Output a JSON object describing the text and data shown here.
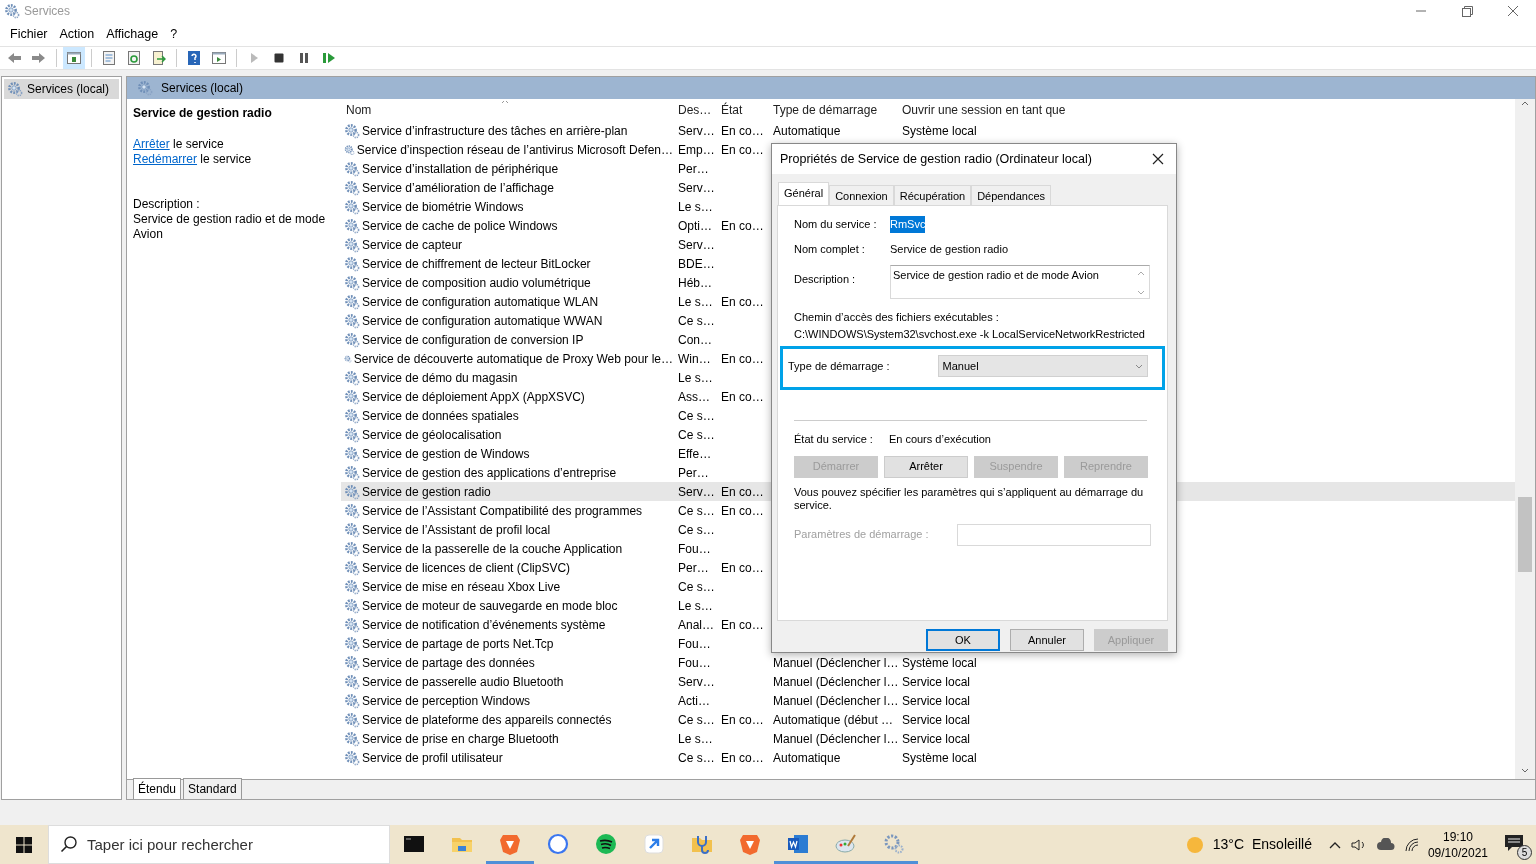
{
  "window": {
    "title": "Services"
  },
  "menu": [
    "Fichier",
    "Action",
    "Affichage",
    "?"
  ],
  "toolbar": [
    {
      "kind": "back",
      "disabled": false,
      "pressed": false
    },
    {
      "kind": "forward",
      "disabled": false,
      "pressed": false
    },
    {
      "kind": "tree",
      "disabled": false,
      "pressed": true
    },
    {
      "kind": "properties",
      "disabled": false,
      "pressed": false
    },
    {
      "kind": "refresh",
      "disabled": false,
      "pressed": false
    },
    {
      "kind": "export",
      "disabled": false,
      "pressed": false
    },
    {
      "kind": "help",
      "disabled": false,
      "pressed": false
    },
    {
      "kind": "view",
      "disabled": false,
      "pressed": false
    },
    {
      "kind": "play",
      "disabled": true,
      "pressed": false
    },
    {
      "kind": "stop",
      "disabled": false,
      "pressed": false
    },
    {
      "kind": "pause",
      "disabled": false,
      "pressed": false
    },
    {
      "kind": "resume",
      "disabled": false,
      "pressed": false
    }
  ],
  "tree": [
    {
      "label": "Services (local)",
      "selected": true
    }
  ],
  "panel_title": "Services (local)",
  "details": {
    "title": "Service de gestion radio",
    "actions": [
      {
        "link": "Arrêter",
        "text": "le service"
      },
      {
        "link": "Redémarrer",
        "text": "le service"
      }
    ],
    "description_label": "Description :",
    "description": "Service de gestion radio et de mode Avion"
  },
  "table": {
    "columns": [
      "Nom",
      "Des…",
      "État",
      "Type de démarrage",
      "Ouvrir une session en tant que"
    ],
    "rows": [
      {
        "name": "Service d’infrastructure des tâches en arrière-plan",
        "description": "Serv…",
        "state": "En co…",
        "startup": "Automatique",
        "logon": "Système local",
        "selected": false
      },
      {
        "name": "Service d’inspection réseau de l’antivirus Microsoft Defen…",
        "description": "Emp…",
        "state": "En co…",
        "selected": false
      },
      {
        "name": "Service d’installation de périphérique",
        "description": "Per…",
        "selected": false
      },
      {
        "name": "Service d’amélioration de l’affichage",
        "description": "Serv…",
        "selected": false
      },
      {
        "name": "Service de biométrie Windows",
        "description": "Le s…",
        "selected": false
      },
      {
        "name": "Service de cache de police Windows",
        "description": "Opti…",
        "state": "En co…",
        "selected": false
      },
      {
        "name": "Service de capteur",
        "description": "Serv…",
        "selected": false
      },
      {
        "name": "Service de chiffrement de lecteur BitLocker",
        "description": "BDE…",
        "selected": false
      },
      {
        "name": "Service de composition audio volumétrique",
        "description": "Héb…",
        "selected": false
      },
      {
        "name": "Service de configuration automatique WLAN",
        "description": "Le s…",
        "state": "En co…",
        "selected": false
      },
      {
        "name": "Service de configuration automatique WWAN",
        "description": "Ce s…",
        "selected": false
      },
      {
        "name": "Service de configuration de conversion IP",
        "description": "Con…",
        "selected": false
      },
      {
        "name": "Service de découverte automatique de Proxy Web pour le…",
        "description": "Win…",
        "state": "En co…",
        "selected": false
      },
      {
        "name": "Service de démo du magasin",
        "description": "Le s…",
        "selected": false
      },
      {
        "name": "Service de déploiement AppX (AppXSVC)",
        "description": "Ass…",
        "state": "En co…",
        "selected": false
      },
      {
        "name": "Service de données spatiales",
        "description": "Ce s…",
        "selected": false
      },
      {
        "name": "Service de géolocalisation",
        "description": "Ce s…",
        "selected": false
      },
      {
        "name": "Service de gestion de Windows",
        "description": "Effe…",
        "selected": false
      },
      {
        "name": "Service de gestion des applications d’entreprise",
        "description": "Per…",
        "selected": false
      },
      {
        "name": "Service de gestion radio",
        "description": "Serv…",
        "state": "En co…",
        "selected": true
      },
      {
        "name": "Service de l’Assistant Compatibilité des programmes",
        "description": "Ce s…",
        "state": "En co…",
        "selected": false
      },
      {
        "name": "Service de l’Assistant de profil local",
        "description": "Ce s…",
        "selected": false
      },
      {
        "name": "Service de la passerelle de la couche Application",
        "description": "Fou…",
        "selected": false
      },
      {
        "name": "Service de licences de client (ClipSVC)",
        "description": "Per…",
        "state": "En co…",
        "selected": false
      },
      {
        "name": "Service de mise en réseau Xbox Live",
        "description": "Ce s…",
        "selected": false
      },
      {
        "name": "Service de moteur de sauvegarde en mode bloc",
        "description": "Le s…",
        "selected": false
      },
      {
        "name": "Service de notification d’événements système",
        "description": "Anal…",
        "state": "En co…",
        "selected": false
      },
      {
        "name": "Service de partage de ports Net.Tcp",
        "description": "Fou…",
        "selected": false
      },
      {
        "name": "Service de partage des données",
        "description": "Fou…",
        "startup": "Manuel (Déclencher l…",
        "logon": "Système local",
        "selected": false
      },
      {
        "name": "Service de passerelle audio Bluetooth",
        "description": "Serv…",
        "startup": "Manuel (Déclencher l…",
        "logon": "Service local",
        "selected": false
      },
      {
        "name": "Service de perception Windows",
        "description": "Acti…",
        "startup": "Manuel (Déclencher l…",
        "logon": "Service local",
        "selected": false
      },
      {
        "name": "Service de plateforme des appareils connectés",
        "description": "Ce s…",
        "state": "En co…",
        "startup": "Automatique (début …",
        "logon": "Service local",
        "selected": false
      },
      {
        "name": "Service de prise en charge Bluetooth",
        "description": "Le s…",
        "startup": "Manuel (Déclencher l…",
        "logon": "Service local",
        "selected": false
      },
      {
        "name": "Service de profil utilisateur",
        "description": "Ce s…",
        "state": "En co…",
        "startup": "Automatique",
        "logon": "Système local",
        "selected": false
      }
    ]
  },
  "view_tabs": [
    {
      "label": "Étendu",
      "selected": true
    },
    {
      "label": "Standard",
      "selected": false
    }
  ],
  "dialog": {
    "title": "Propriétés de Service de gestion radio (Ordinateur local)",
    "tabs": [
      {
        "label": "Général",
        "selected": true
      },
      {
        "label": "Connexion",
        "selected": false
      },
      {
        "label": "Récupération",
        "selected": false
      },
      {
        "label": "Dépendances",
        "selected": false
      }
    ],
    "service_name": {
      "label": "Nom du service :",
      "value": "RmSvc"
    },
    "display_name": {
      "label": "Nom complet :",
      "value": "Service de gestion radio"
    },
    "description": {
      "label": "Description :",
      "value": "Service de gestion radio et de mode Avion"
    },
    "path": {
      "label": "Chemin d’accès des fichiers exécutables :",
      "value": "C:\\WINDOWS\\System32\\svchost.exe -k LocalServiceNetworkRestricted"
    },
    "startup_type": {
      "label": "Type de démarrage :",
      "value": "Manuel",
      "highlighted": true
    },
    "status": {
      "label": "État du service :",
      "value": "En cours d’exécution"
    },
    "service_buttons": [
      {
        "label": "Démarrer",
        "disabled": true
      },
      {
        "label": "Arrêter",
        "disabled": false
      },
      {
        "label": "Suspendre",
        "disabled": true
      },
      {
        "label": "Reprendre",
        "disabled": true
      }
    ],
    "note": "Vous pouvez spécifier les paramètres qui s’appliquent au démarrage du service.",
    "parameters": {
      "label": "Paramètres de démarrage :",
      "disabled": true
    },
    "footer_buttons": [
      {
        "label": "OK",
        "disabled": false,
        "default": true
      },
      {
        "label": "Annuler",
        "disabled": false,
        "default": false
      },
      {
        "label": "Appliquer",
        "disabled": true,
        "default": false
      }
    ]
  },
  "taskbar": {
    "search": {
      "placeholder": "Taper ici pour rechercher"
    },
    "apps": [
      {
        "kind": "terminal",
        "active": false
      },
      {
        "kind": "folder",
        "active": false
      },
      {
        "kind": "lion",
        "active": true
      },
      {
        "kind": "chat",
        "active": false
      },
      {
        "kind": "music",
        "active": false
      },
      {
        "kind": "arrow",
        "active": false
      },
      {
        "kind": "stethoscope",
        "active": false
      },
      {
        "kind": "lion",
        "active": false
      },
      {
        "kind": "word",
        "active": true
      },
      {
        "kind": "palette",
        "active": true
      },
      {
        "kind": "gears",
        "active": true
      }
    ],
    "weather": {
      "temperature": "13°C",
      "condition": "Ensoleillé"
    },
    "time": "19:10",
    "date": "09/10/2021",
    "notifications": "5"
  }
}
